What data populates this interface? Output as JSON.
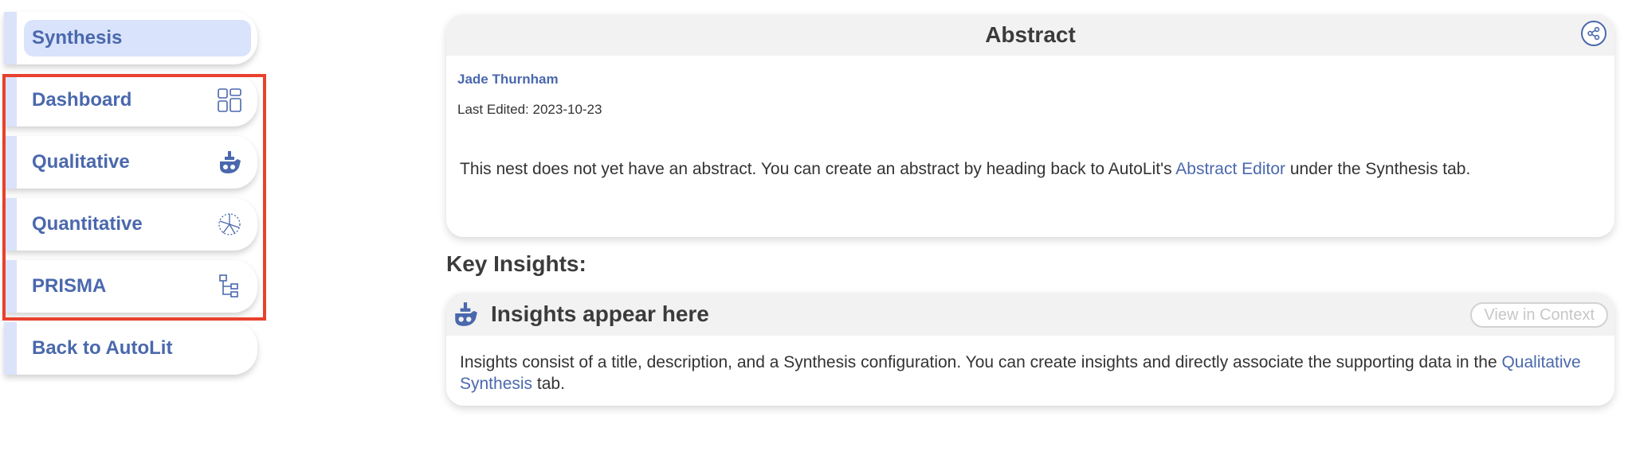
{
  "sidebar": {
    "items": [
      {
        "label": "Synthesis",
        "icon": "none"
      },
      {
        "label": "Dashboard",
        "icon": "dashboard-icon"
      },
      {
        "label": "Qualitative",
        "icon": "qualitative-icon"
      },
      {
        "label": "Quantitative",
        "icon": "quantitative-icon"
      },
      {
        "label": "PRISMA",
        "icon": "prisma-icon"
      },
      {
        "label": "Back to AutoLit",
        "icon": "none"
      }
    ],
    "highlight_color": "#e8412e"
  },
  "abstract": {
    "title": "Abstract",
    "author": "Jade Thurnham",
    "last_edited": "Last Edited: 2023-10-23",
    "body_pre": "This nest does not yet have an abstract. You can create an abstract by heading back to AutoLit's ",
    "body_link": "Abstract Editor",
    "body_post": " under the Synthesis tab."
  },
  "key_insights": {
    "heading": "Key Insights:",
    "title": "Insights appear here",
    "view_button": "View in Context",
    "body_pre": "Insights consist of a title, description, and a Synthesis configuration. You can create insights and directly associate the supporting data in the ",
    "body_link": "Qualitative Synthesis",
    "body_post": " tab."
  },
  "colors": {
    "accent": "#4a68ad",
    "tab_stripe": "#dbe3fa"
  }
}
